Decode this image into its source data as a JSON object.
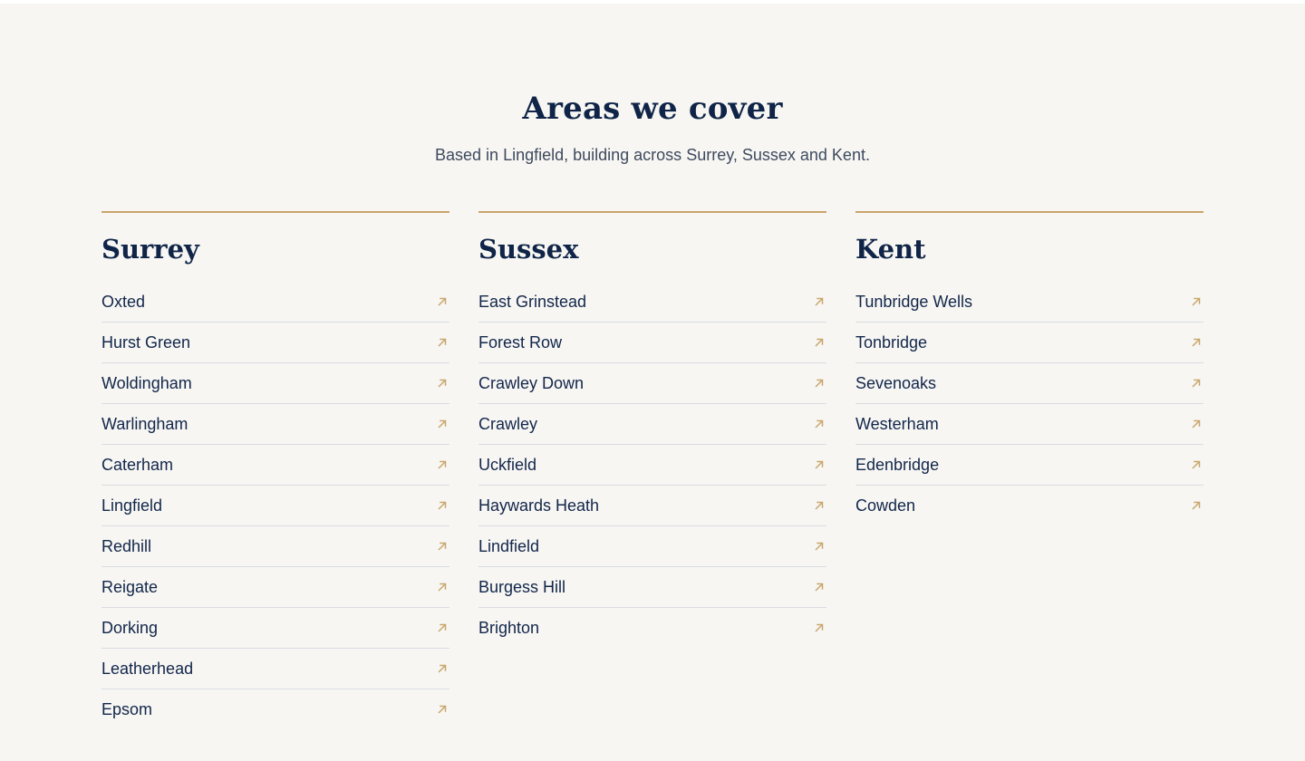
{
  "header": {
    "title": "Areas we cover",
    "subtitle": "Based in Lingfield, building across Surrey, Sussex and Kent."
  },
  "colors": {
    "accent": "#c9a66b",
    "heading": "#0f2447",
    "background": "#f7f6f3",
    "divider": "#dadce2"
  },
  "icons": {
    "item_arrow": "arrow-up-right-icon"
  },
  "regions": [
    {
      "name": "Surrey",
      "areas": [
        "Oxted",
        "Hurst Green",
        "Woldingham",
        "Warlingham",
        "Caterham",
        "Lingfield",
        "Redhill",
        "Reigate",
        "Dorking",
        "Leatherhead",
        "Epsom"
      ]
    },
    {
      "name": "Sussex",
      "areas": [
        "East Grinstead",
        "Forest Row",
        "Crawley Down",
        "Crawley",
        "Uckfield",
        "Haywards Heath",
        "Lindfield",
        "Burgess Hill",
        "Brighton"
      ]
    },
    {
      "name": "Kent",
      "areas": [
        "Tunbridge Wells",
        "Tonbridge",
        "Sevenoaks",
        "Westerham",
        "Edenbridge",
        "Cowden"
      ]
    }
  ]
}
